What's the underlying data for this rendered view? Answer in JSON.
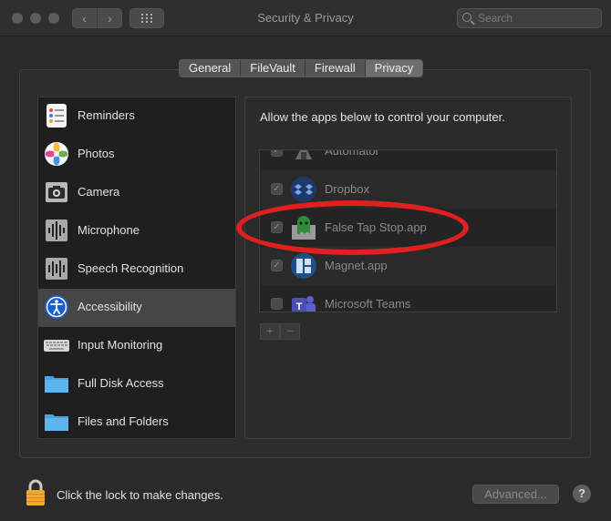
{
  "window": {
    "title": "Security & Privacy",
    "search_placeholder": "Search"
  },
  "tabs": [
    {
      "label": "General"
    },
    {
      "label": "FileVault"
    },
    {
      "label": "Firewall"
    },
    {
      "label": "Privacy",
      "selected": true
    }
  ],
  "sidebar": {
    "items": [
      {
        "label": "Reminders",
        "icon": "reminders-icon"
      },
      {
        "label": "Photos",
        "icon": "photos-icon"
      },
      {
        "label": "Camera",
        "icon": "camera-icon"
      },
      {
        "label": "Microphone",
        "icon": "microphone-icon"
      },
      {
        "label": "Speech Recognition",
        "icon": "speech-recognition-icon"
      },
      {
        "label": "Accessibility",
        "icon": "accessibility-icon",
        "selected": true
      },
      {
        "label": "Input Monitoring",
        "icon": "keyboard-icon"
      },
      {
        "label": "Full Disk Access",
        "icon": "folder-icon"
      },
      {
        "label": "Files and Folders",
        "icon": "folder-icon"
      }
    ]
  },
  "content": {
    "heading": "Allow the apps below to control your computer.",
    "apps": [
      {
        "name": "Automator",
        "checked": true,
        "icon": "automator-icon"
      },
      {
        "name": "Dropbox",
        "checked": true,
        "icon": "dropbox-icon"
      },
      {
        "name": "False Tap Stop.app",
        "checked": true,
        "icon": "ghost-icon"
      },
      {
        "name": "Magnet.app",
        "checked": true,
        "icon": "magnet-icon"
      },
      {
        "name": "Microsoft Teams",
        "checked": false,
        "icon": "teams-icon"
      }
    ],
    "add_label": "+",
    "remove_label": "−"
  },
  "footer": {
    "lock_text": "Click the lock to make changes.",
    "advanced_label": "Advanced...",
    "help_label": "?"
  },
  "colors": {
    "highlight": "#e02020",
    "selected_row": "#464646"
  }
}
